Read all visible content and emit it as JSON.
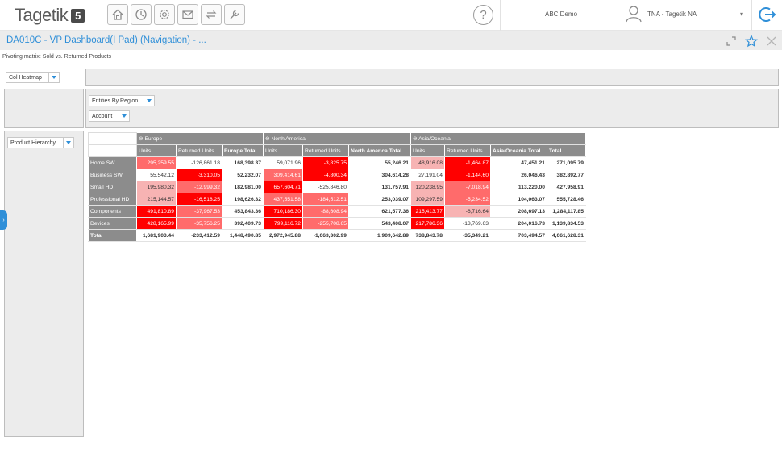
{
  "app": {
    "logo_text": "Tagetik",
    "logo_badge": "5"
  },
  "topbar": {
    "icons": [
      "home-icon",
      "history-icon",
      "settings-icon",
      "mail-icon",
      "transfer-icon",
      "tools-icon"
    ],
    "help": "?",
    "environment": "ABC Demo",
    "user": "TNA - Tagetik NA",
    "user_caret": "▾"
  },
  "window": {
    "title": "DA010C - VP Dashboard(I Pad) (Navigation) - ...",
    "subtitle": "Pivoting matrix: Sold vs. Returned Products"
  },
  "selectors": {
    "view": "Col Heatmap",
    "columns_1": "Entities By Region",
    "columns_2": "Account",
    "rows": "Product Hierarchy"
  },
  "colors": {
    "accent": "#2f8fd8",
    "header": "#8c8c8c",
    "heat_strong": "#ff0000",
    "heat_mid": "#ff6b6b",
    "heat_light": "#f7b3b3"
  },
  "grid": {
    "regions": [
      "Europe",
      "North America",
      "Asia/Oceania"
    ],
    "columns": [
      "Units",
      "Returned Units",
      "Europe Total",
      "Units",
      "Returned Units",
      "North America Total",
      "Units",
      "Returned Units",
      "Asia/Oceania Total",
      "Total"
    ],
    "rows": [
      {
        "label": "Home SW",
        "values": [
          "295,259.55",
          "-126,861.18",
          "168,398.37",
          "59,071.96",
          "-3,825.75",
          "55,246.21",
          "48,916.08",
          "-1,464.87",
          "47,451.21",
          "271,095.79"
        ]
      },
      {
        "label": "Business SW",
        "values": [
          "55,542.12",
          "-3,310.05",
          "52,232.07",
          "309,414.61",
          "-4,800.34",
          "304,614.28",
          "27,191.04",
          "-1,144.60",
          "26,046.43",
          "382,892.77"
        ]
      },
      {
        "label": "Small HD",
        "values": [
          "195,980.32",
          "-12,999.32",
          "182,981.00",
          "657,604.71",
          "-525,846.80",
          "131,757.91",
          "120,238.95",
          "-7,018.94",
          "113,220.00",
          "427,958.91"
        ]
      },
      {
        "label": "Professional HD",
        "values": [
          "215,144.57",
          "-16,518.25",
          "198,626.32",
          "437,551.58",
          "-184,512.51",
          "253,039.07",
          "109,297.59",
          "-5,234.52",
          "104,063.07",
          "555,728.46"
        ]
      },
      {
        "label": "Components",
        "values": [
          "491,810.89",
          "-37,967.53",
          "453,843.36",
          "710,186.30",
          "-88,608.94",
          "621,577.36",
          "215,413.77",
          "-6,716.64",
          "208,697.13",
          "1,284,117.85"
        ]
      },
      {
        "label": "Devices",
        "values": [
          "428,165.99",
          "-35,756.25",
          "392,409.73",
          "799,116.72",
          "-255,708.65",
          "543,408.07",
          "217,786.36",
          "-13,769.63",
          "204,016.73",
          "1,139,834.53"
        ]
      },
      {
        "label": "Total",
        "values": [
          "1,681,903.44",
          "-233,412.59",
          "1,448,490.85",
          "2,972,945.88",
          "-1,063,302.99",
          "1,909,642.89",
          "738,843.78",
          "-35,349.21",
          "703,494.57",
          "4,061,628.31"
        ]
      }
    ],
    "heat": [
      [
        "m",
        "",
        "",
        "",
        "s",
        "",
        "l",
        "s",
        "",
        ""
      ],
      [
        "",
        "s",
        "",
        "m",
        "s",
        "",
        "",
        "s",
        "",
        ""
      ],
      [
        "l",
        "m",
        "",
        "s",
        "",
        "",
        "l",
        "m",
        "",
        ""
      ],
      [
        "l",
        "s",
        "",
        "m",
        "m",
        "",
        "l",
        "m",
        "",
        ""
      ],
      [
        "s",
        "m",
        "",
        "s",
        "m",
        "",
        "s",
        "l",
        "",
        ""
      ],
      [
        "s",
        "m",
        "",
        "s",
        "m",
        "",
        "s",
        "",
        "",
        ""
      ],
      [
        "",
        "",
        "",
        "",
        "",
        "",
        "",
        "",
        "",
        ""
      ]
    ]
  }
}
